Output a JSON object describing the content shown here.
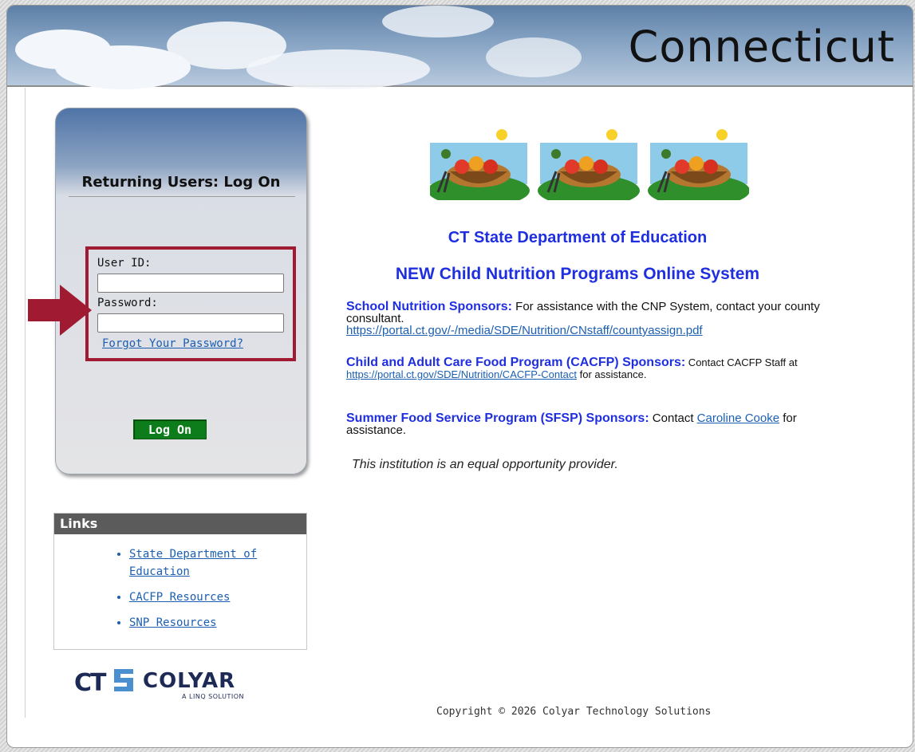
{
  "banner": {
    "title": "Connecticut"
  },
  "login": {
    "title": "Returning Users: Log On",
    "user_id_label": "User ID:",
    "user_id_value": "",
    "password_label": "Password:",
    "password_value": "",
    "forgot_link": "Forgot Your Password?",
    "logon_button": "Log On"
  },
  "links": {
    "header": "Links",
    "items": [
      {
        "label": "State Department of Education"
      },
      {
        "label": "CACFP Resources"
      },
      {
        "label": "SNP Resources"
      }
    ]
  },
  "logo": {
    "brand": "COLYAR",
    "mark": "CT",
    "tagline": "A LINQ SOLUTION"
  },
  "main": {
    "heading1": "CT State Department of Education",
    "heading2": "NEW Child Nutrition Programs Online System",
    "school": {
      "label": "School Nutrition Sponsors:",
      "text": " For assistance with the CNP System, contact your county consultant.",
      "link": "https://portal.ct.gov/-/media/SDE/Nutrition/CNstaff/countyassign.pdf"
    },
    "cacfp": {
      "label": "Child and Adult Care Food Program (CACFP) Sponsors:",
      "text_a": " Contact CACFP Staff at ",
      "link": "https://portal.ct.gov/SDE/Nutrition/CACFP-Contact",
      "text_b": " for assistance."
    },
    "sfsp": {
      "label": "Summer Food Service Program (SFSP) Sponsors:",
      "text_a": " Contact ",
      "link": "Caroline Cooke",
      "text_b": " for assistance."
    },
    "equal_opportunity": "This institution is an equal opportunity provider."
  },
  "footer": {
    "copyright": "Copyright © 2026 Colyar Technology Solutions"
  },
  "colors": {
    "link": "#1b5fb3",
    "heading": "#1f2fe0",
    "highlight": "#a01a31",
    "button": "#0d7d1b"
  }
}
